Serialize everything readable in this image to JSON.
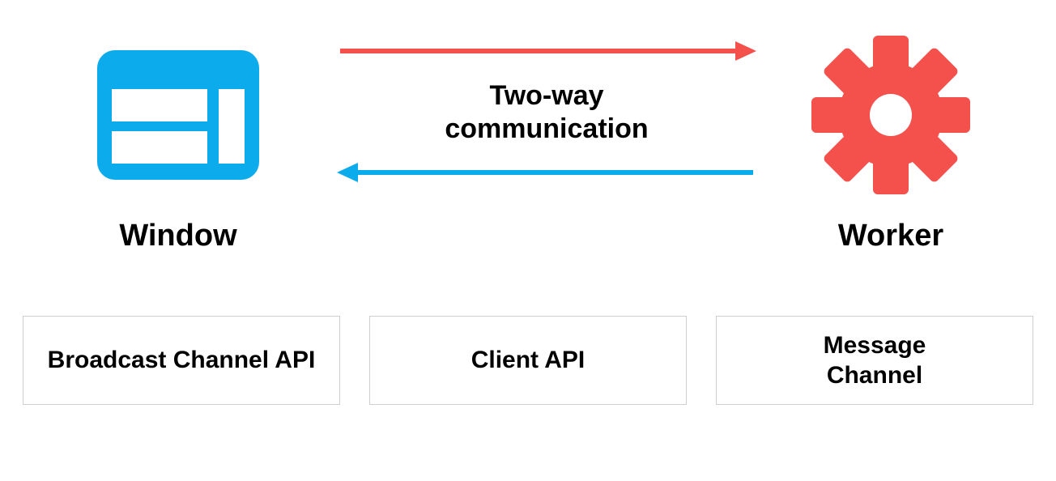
{
  "window": {
    "label": "Window"
  },
  "worker": {
    "label": "Worker"
  },
  "center": {
    "line1": "Two-way",
    "line2": "communication"
  },
  "boxes": {
    "broadcast": "Broadcast Channel API",
    "client": "Client API",
    "message_line1": "Message",
    "message_line2": "Channel"
  },
  "colors": {
    "blue": "#0cabeb",
    "red": "#f4514d",
    "border": "#cfcfcf"
  }
}
